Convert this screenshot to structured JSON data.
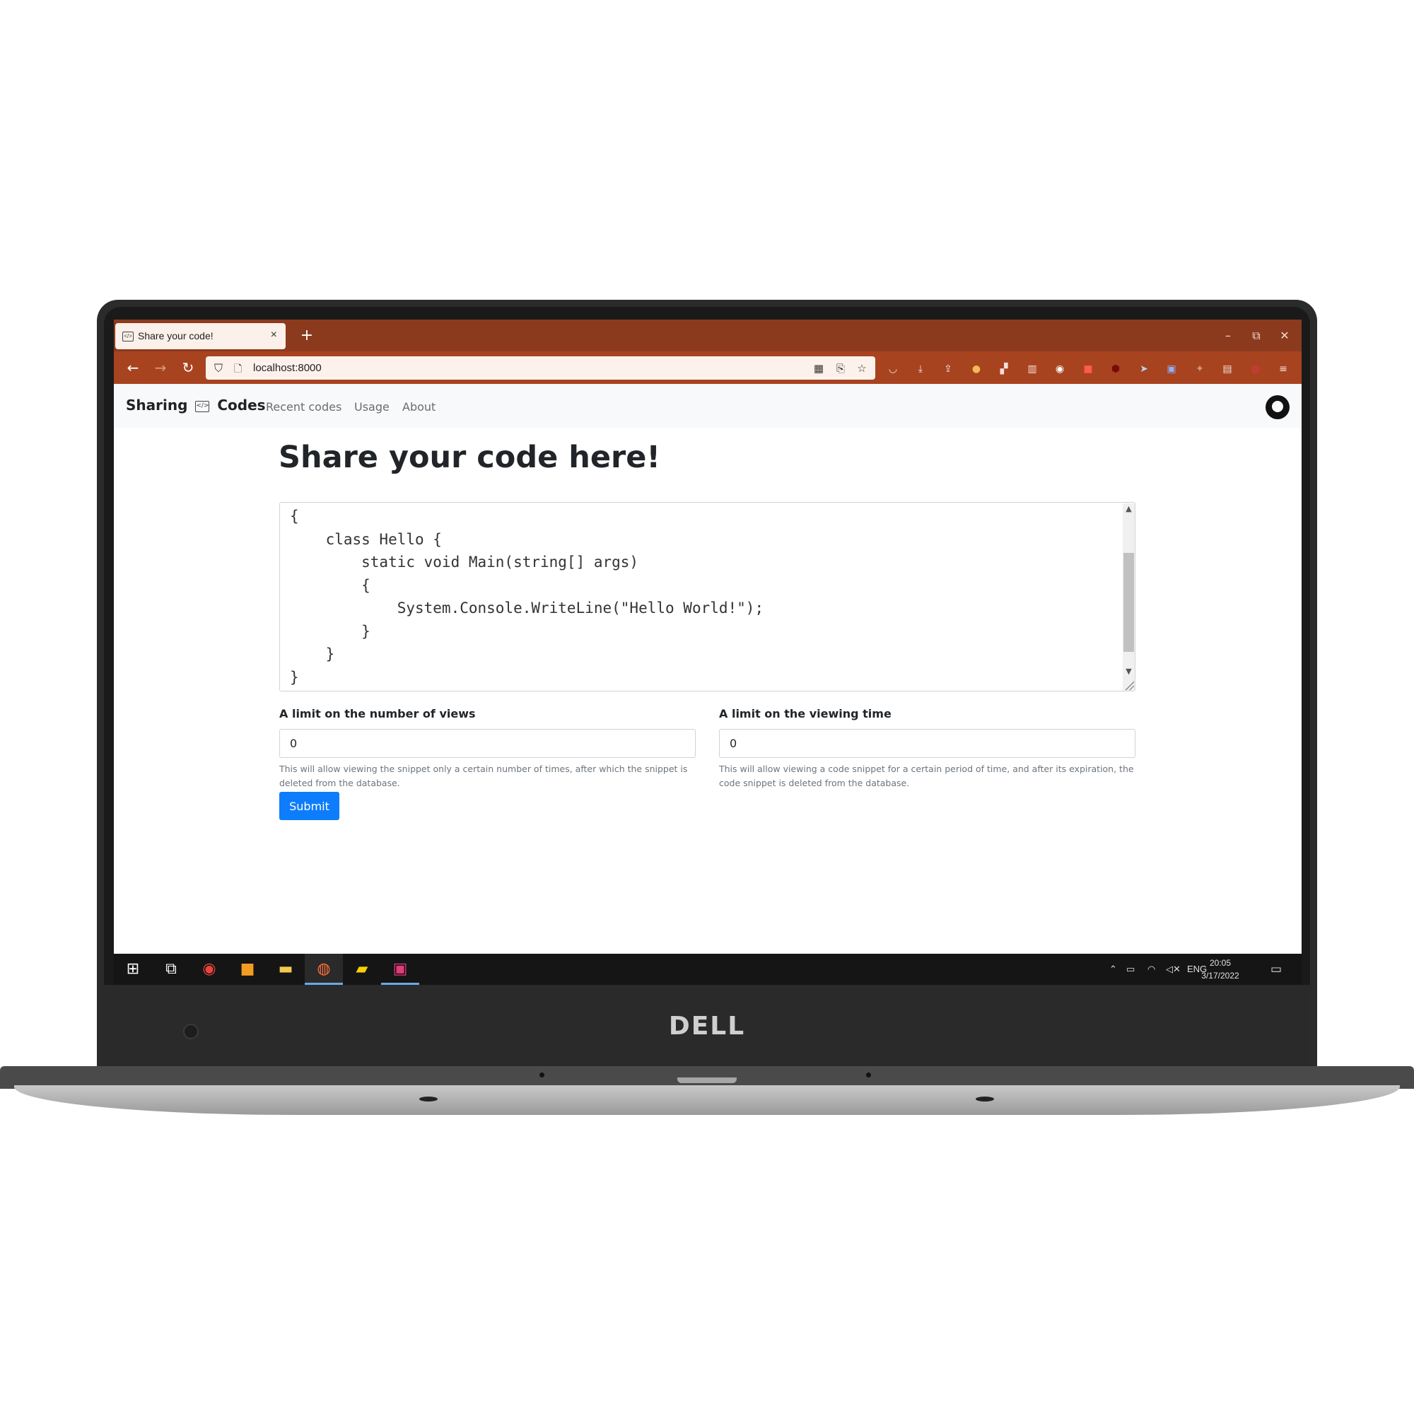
{
  "browser": {
    "tab_title": "Share your code!",
    "tab_close": "×",
    "new_tab": "+",
    "url": "localhost:8000",
    "window_controls": {
      "minimize": "–",
      "restore": "⧉",
      "close": "✕"
    }
  },
  "site": {
    "brand_left": "Sharing",
    "brand_icon": "</>",
    "brand_right": "Codes",
    "nav": [
      {
        "label": "Recent codes"
      },
      {
        "label": "Usage"
      },
      {
        "label": "About"
      }
    ]
  },
  "main": {
    "title": "Share your code here!",
    "code": "{\n    class Hello {\n        static void Main(string[] args)\n        {\n            System.Console.WriteLine(\"Hello World!\");\n        }\n    }\n}",
    "views_label": "A limit on the number of views",
    "views_value": "0",
    "views_help": "This will allow viewing the snippet only a certain number of times, after which the snippet is deleted from the database.",
    "time_label": "A limit on the viewing time",
    "time_value": "0",
    "time_help": "This will allow viewing a code snippet for a certain period of time, and after its expiration, the code snippet is deleted from the database.",
    "submit_label": "Submit"
  },
  "taskbar": {
    "language": "ENG",
    "time": "20:05",
    "date": "3/17/2022"
  },
  "device": {
    "brand": "DELL"
  },
  "colors": {
    "tab_strip": "#8c3a1e",
    "toolbar": "#a8431f",
    "submit_button": "#0d7dfc"
  }
}
